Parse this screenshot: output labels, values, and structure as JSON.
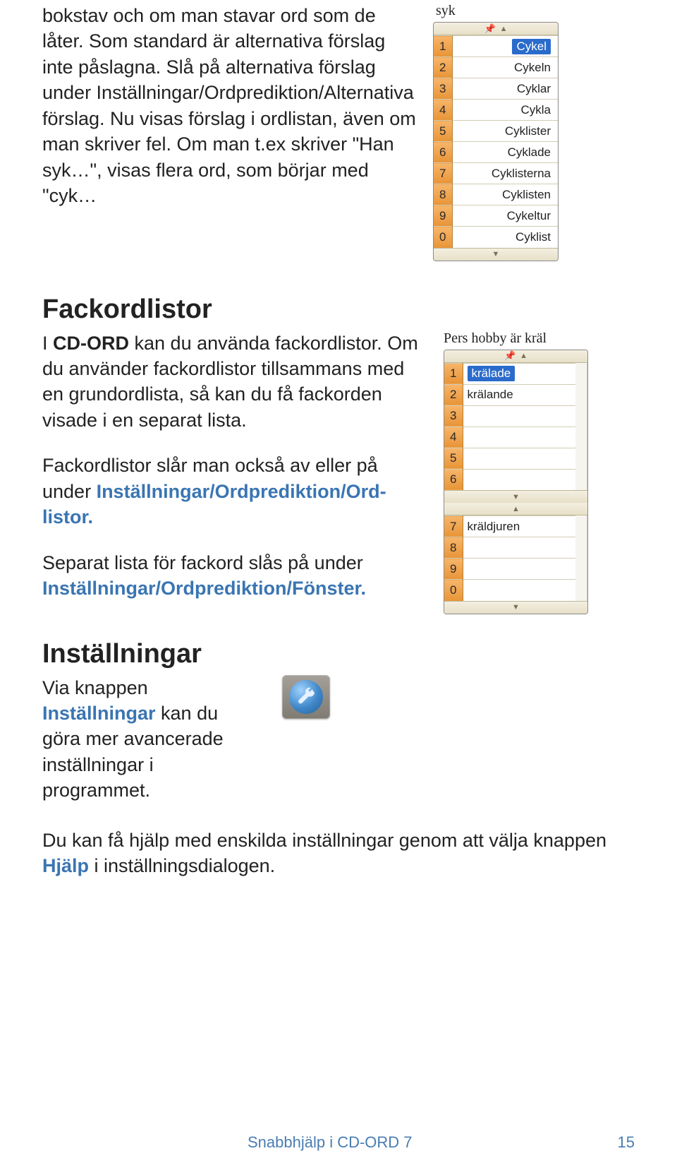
{
  "para1": "bokstav och om man stavar ord som de låter. Som standard är alternativa förslag inte påslagna. Slå på alternativa förslag under Inställningar/Ordprediktion/Alternativa förslag. Nu visas förslag i ordlistan, även om man skriver fel. Om man t.ex skriver \"Han syk…\", visas flera ord, som börjar med \"cyk…",
  "typed1": "syk",
  "list1": {
    "rows": [
      {
        "n": "1",
        "w": "Cykel",
        "sel": true
      },
      {
        "n": "2",
        "w": "Cykeln"
      },
      {
        "n": "3",
        "w": "Cyklar"
      },
      {
        "n": "4",
        "w": "Cykla"
      },
      {
        "n": "5",
        "w": "Cyklister"
      },
      {
        "n": "6",
        "w": "Cyklade"
      },
      {
        "n": "7",
        "w": "Cyklisterna"
      },
      {
        "n": "8",
        "w": "Cyklisten"
      },
      {
        "n": "9",
        "w": "Cykeltur"
      },
      {
        "n": "0",
        "w": "Cyklist"
      }
    ]
  },
  "h_fack": "Fackordlistor",
  "fack_p1a": "I ",
  "fack_p1b": "CD-ORD",
  "fack_p1c": " kan du använda fackordlistor. Om du använder fackordlistor tillsammans med en grundordlista, så kan du få fackor­den visade i en separat lista.",
  "fack_p2a": "Fackordlistor slår man också av eller på under ",
  "fack_p2b": "Inställningar/Ordprediktion/Ord­listor.",
  "fack_p3a": "Separat lista för fackord slås på under ",
  "fack_p3b": "Inställningar/Ordprediktion/Fönster.",
  "typed2": "Pers hobby är kräl",
  "list2": {
    "top": [
      {
        "n": "1",
        "w": "krälade",
        "sel": true
      },
      {
        "n": "2",
        "w": "krälande"
      },
      {
        "n": "3",
        "w": ""
      },
      {
        "n": "4",
        "w": ""
      },
      {
        "n": "5",
        "w": ""
      },
      {
        "n": "6",
        "w": ""
      }
    ],
    "bottom": [
      {
        "n": "7",
        "w": "kräldjuren"
      },
      {
        "n": "8",
        "w": ""
      },
      {
        "n": "9",
        "w": ""
      },
      {
        "n": "0",
        "w": ""
      }
    ]
  },
  "h_inst": "Inställningar",
  "inst_p1a": "Via knappen ",
  "inst_p1b": "Inställningar",
  "inst_p1c": " kan du göra mer avance­rade inställningar i programmet.",
  "inst_p2a": "Du kan få hjälp med enskilda inställningar genom att välja knappen ",
  "inst_p2b": "Hjälp",
  "inst_p2c": " i inställningsdialogen.",
  "footer_title": "Snabbhjälp i CD-ORD 7",
  "footer_page": "15"
}
